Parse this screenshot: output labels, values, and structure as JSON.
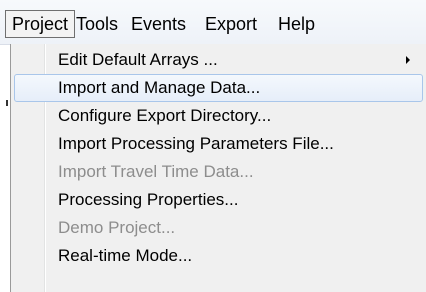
{
  "menubar": {
    "items": [
      {
        "label": "Project"
      },
      {
        "label": "Tools"
      },
      {
        "label": "Events"
      },
      {
        "label": "Export"
      },
      {
        "label": "Help"
      }
    ]
  },
  "project_menu": {
    "items": [
      {
        "label": "Edit Default Arrays ..."
      },
      {
        "label": "Import and Manage Data..."
      },
      {
        "label": "Configure Export Directory..."
      },
      {
        "label": "Import Processing Parameters File..."
      },
      {
        "label": "Import Travel Time Data..."
      },
      {
        "label": "Processing Properties..."
      },
      {
        "label": "Demo Project..."
      },
      {
        "label": "Real-time Mode..."
      }
    ],
    "submenu_arrow_icon": "chevron-right-icon",
    "highlight_color": "#e6eef9",
    "disabled_text_color": "#8d8d8d"
  }
}
